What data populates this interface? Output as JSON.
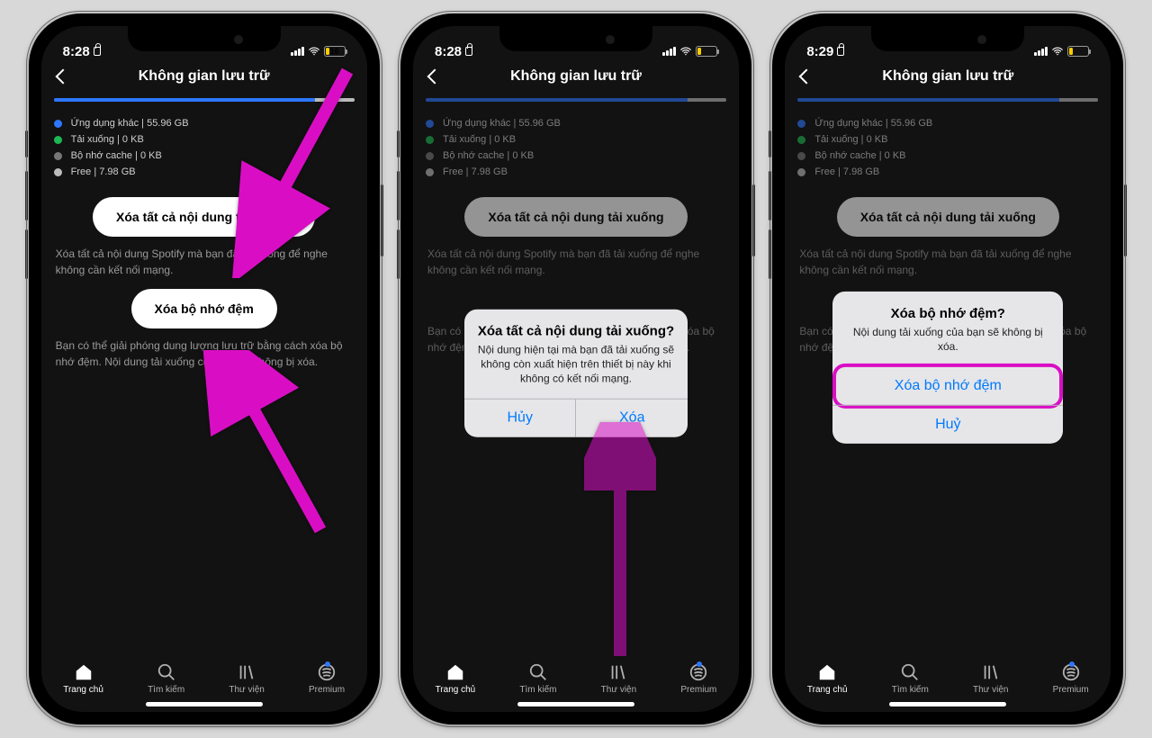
{
  "phones": [
    {
      "time": "8:28",
      "battery": "16"
    },
    {
      "time": "8:28",
      "battery": ""
    },
    {
      "time": "8:29",
      "battery": ""
    }
  ],
  "header": {
    "title": "Không gian lưu trữ"
  },
  "legend": {
    "other_apps": "Ứng dụng khác | 55.96 GB",
    "downloads": "Tải xuống | 0 KB",
    "cache": "Bộ nhớ cache | 0 KB",
    "free": "Free | 7.98 GB"
  },
  "buttons": {
    "delete_downloads": "Xóa tất cả nội dung tải xuống",
    "delete_cache": "Xóa bộ nhớ đệm"
  },
  "help": {
    "downloads": "Xóa tất cả nội dung Spotify mà bạn đã tải xuống để nghe không cần kết nối mạng.",
    "cache": "Bạn có thể giải phóng dung lượng lưu trữ bằng cách xóa bộ nhớ đệm. Nội dung tải xuống của bạn sẽ không bị xóa."
  },
  "tabs": {
    "home": "Trang chủ",
    "search": "Tìm kiếm",
    "library": "Thư viện",
    "premium": "Premium"
  },
  "dialog_downloads": {
    "title": "Xóa tất cả nội dung tải xuống?",
    "msg": "Nội dung hiện tại mà bạn đã tải xuống sẽ không còn xuất hiện trên thiết bị này khi không có kết nối mạng.",
    "cancel": "Hủy",
    "confirm": "Xóa"
  },
  "dialog_cache": {
    "title": "Xóa bộ nhớ đệm?",
    "msg": "Nội dung tải xuống của bạn sẽ không bị xóa.",
    "confirm": "Xóa bộ nhớ đệm",
    "cancel": "Huỷ"
  }
}
